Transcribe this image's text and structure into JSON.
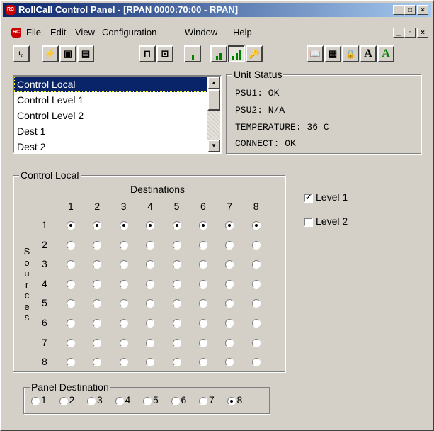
{
  "window": {
    "title": "RollCall Control Panel - [RPAN 0000:70:00 - RPAN]",
    "icon_text": "Roll\nCall",
    "caption_buttons": [
      "_",
      "□",
      "×"
    ],
    "mdi_buttons": [
      "_",
      "▫",
      "×"
    ]
  },
  "menu": [
    "File",
    "Edit",
    "View",
    "Configuration",
    "Window",
    "Help"
  ],
  "toolbar": {
    "buttons": [
      {
        "name": "connect-icon",
        "glyph": "ᵗ₀"
      },
      {
        "name": "lightning-icon",
        "glyph": "⚡"
      },
      {
        "name": "save-icon",
        "glyph": "▣"
      },
      {
        "name": "save-as-icon",
        "glyph": "▤"
      },
      {
        "name": "network-icon",
        "glyph": "⊓"
      },
      {
        "name": "device-icon",
        "glyph": "⊡"
      },
      {
        "name": "level-low-icon",
        "glyph": ""
      },
      {
        "name": "level-mid-icon",
        "glyph": ""
      },
      {
        "name": "level-high-icon",
        "glyph": ""
      },
      {
        "name": "key-icon",
        "glyph": "🔑"
      },
      {
        "name": "book-icon",
        "glyph": "📖"
      },
      {
        "name": "table-icon",
        "glyph": "▦"
      },
      {
        "name": "lock-icon",
        "glyph": "🔒"
      },
      {
        "name": "font-black-icon",
        "glyph": "A"
      },
      {
        "name": "font-green-icon",
        "glyph": "A"
      }
    ]
  },
  "list": {
    "items": [
      "Control Local",
      "Control Level 1",
      "Control Level 2",
      "Dest 1",
      "Dest 2"
    ],
    "selected_index": 0
  },
  "unit_status": {
    "label": "Unit Status",
    "lines": [
      "PSU1: OK",
      "PSU2: N/A",
      "TEMPERATURE: 36 C",
      "CONNECT: OK"
    ]
  },
  "matrix": {
    "group_label": "Control Local",
    "destinations_label": "Destinations",
    "sources_label": [
      "S",
      "o",
      "u",
      "r",
      "c",
      "e",
      "s"
    ],
    "columns": [
      "1",
      "2",
      "3",
      "4",
      "5",
      "6",
      "7",
      "8"
    ],
    "rows": [
      "1",
      "2",
      "3",
      "4",
      "5",
      "6",
      "7",
      "8"
    ],
    "selected_row": 1
  },
  "levels": [
    {
      "label": "Level 1",
      "checked": true
    },
    {
      "label": "Level 2",
      "checked": false
    }
  ],
  "panel_destination": {
    "label": "Panel Destination",
    "options": [
      "1",
      "2",
      "3",
      "4",
      "5",
      "6",
      "7",
      "8"
    ],
    "selected": "8"
  },
  "colors": {
    "title_gradient_start": "#0a246a",
    "title_gradient_end": "#a6caf0",
    "selection": "#0a246a",
    "face": "#d4d0c8",
    "level_bars": "#008000"
  }
}
